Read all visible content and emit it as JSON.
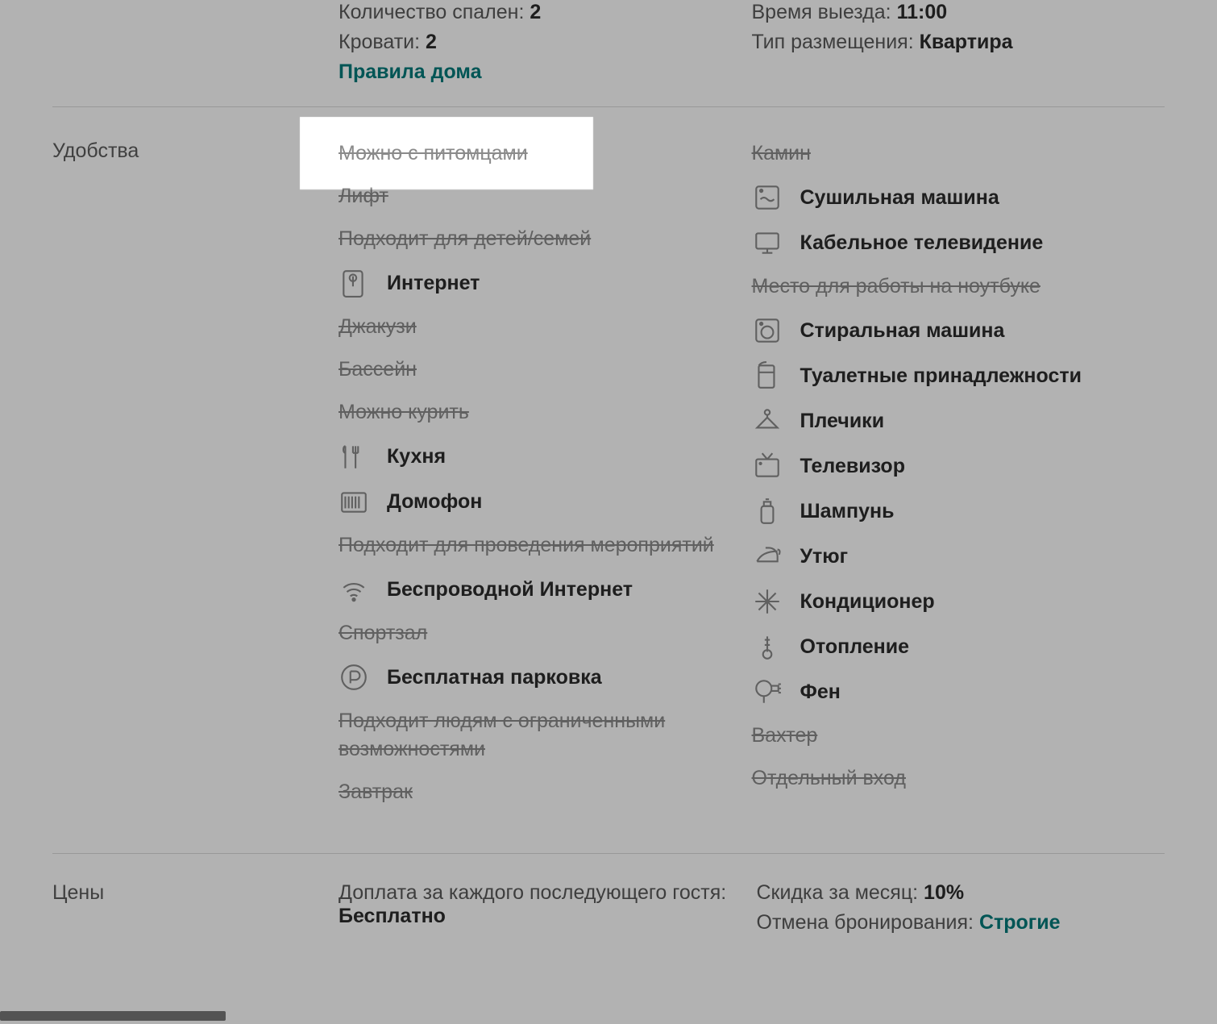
{
  "topInfo": {
    "leftLines": [
      {
        "label": "Количество спален: ",
        "value": "2"
      },
      {
        "label": "Кровати: ",
        "value": "2"
      }
    ],
    "houseRulesLink": "Правила дома",
    "rightLines": [
      {
        "label": "Время выезда: ",
        "value": "11:00"
      },
      {
        "label": "Тип размещения: ",
        "value": "Квартира"
      }
    ]
  },
  "amenitiesLabel": "Удобства",
  "amenitiesLeft": [
    {
      "label": "Можно с питомцами",
      "available": false,
      "icon": ""
    },
    {
      "label": "Лифт",
      "available": false,
      "icon": ""
    },
    {
      "label": "Подходит для детей/семей",
      "available": false,
      "icon": ""
    },
    {
      "label": "Интернет",
      "available": true,
      "icon": "internet"
    },
    {
      "label": "Джакузи",
      "available": false,
      "icon": ""
    },
    {
      "label": "Бассейн",
      "available": false,
      "icon": ""
    },
    {
      "label": "Можно курить",
      "available": false,
      "icon": ""
    },
    {
      "label": "Кухня",
      "available": true,
      "icon": "kitchen"
    },
    {
      "label": "Домофон",
      "available": true,
      "icon": "intercom"
    },
    {
      "label": "Подходит для проведения мероприятий",
      "available": false,
      "icon": ""
    },
    {
      "label": "Беспроводной Интернет",
      "available": true,
      "icon": "wifi"
    },
    {
      "label": "Спортзал",
      "available": false,
      "icon": ""
    },
    {
      "label": "Бесплатная парковка",
      "available": true,
      "icon": "parking"
    },
    {
      "label": "Подходит людям с ограниченными возможностями",
      "available": false,
      "icon": ""
    },
    {
      "label": "Завтрак",
      "available": false,
      "icon": ""
    }
  ],
  "amenitiesRight": [
    {
      "label": "Камин",
      "available": false,
      "icon": ""
    },
    {
      "label": "Сушильная машина",
      "available": true,
      "icon": "dryer"
    },
    {
      "label": "Кабельное телевидение",
      "available": true,
      "icon": "cabletv"
    },
    {
      "label": "Место для работы на ноутбуке",
      "available": false,
      "icon": ""
    },
    {
      "label": "Стиральная машина",
      "available": true,
      "icon": "washer"
    },
    {
      "label": "Туалетные принадлежности",
      "available": true,
      "icon": "toiletries"
    },
    {
      "label": "Плечики",
      "available": true,
      "icon": "hanger"
    },
    {
      "label": "Телевизор",
      "available": true,
      "icon": "tv"
    },
    {
      "label": "Шампунь",
      "available": true,
      "icon": "shampoo"
    },
    {
      "label": "Утюг",
      "available": true,
      "icon": "iron"
    },
    {
      "label": "Кондиционер",
      "available": true,
      "icon": "ac"
    },
    {
      "label": "Отопление",
      "available": true,
      "icon": "heating"
    },
    {
      "label": "Фен",
      "available": true,
      "icon": "hairdryer"
    },
    {
      "label": "Вахтер",
      "available": false,
      "icon": ""
    },
    {
      "label": "Отдельный вход",
      "available": false,
      "icon": ""
    }
  ],
  "pricesLabel": "Цены",
  "prices": {
    "leftLines": [
      {
        "label": "Доплата за каждого последующего гостя: ",
        "value": "Бесплатно"
      }
    ],
    "rightLines": [
      {
        "label": "Скидка за месяц: ",
        "value": "10%"
      },
      {
        "label": "Отмена бронирования: ",
        "value": "Строгие",
        "link": true
      }
    ]
  }
}
